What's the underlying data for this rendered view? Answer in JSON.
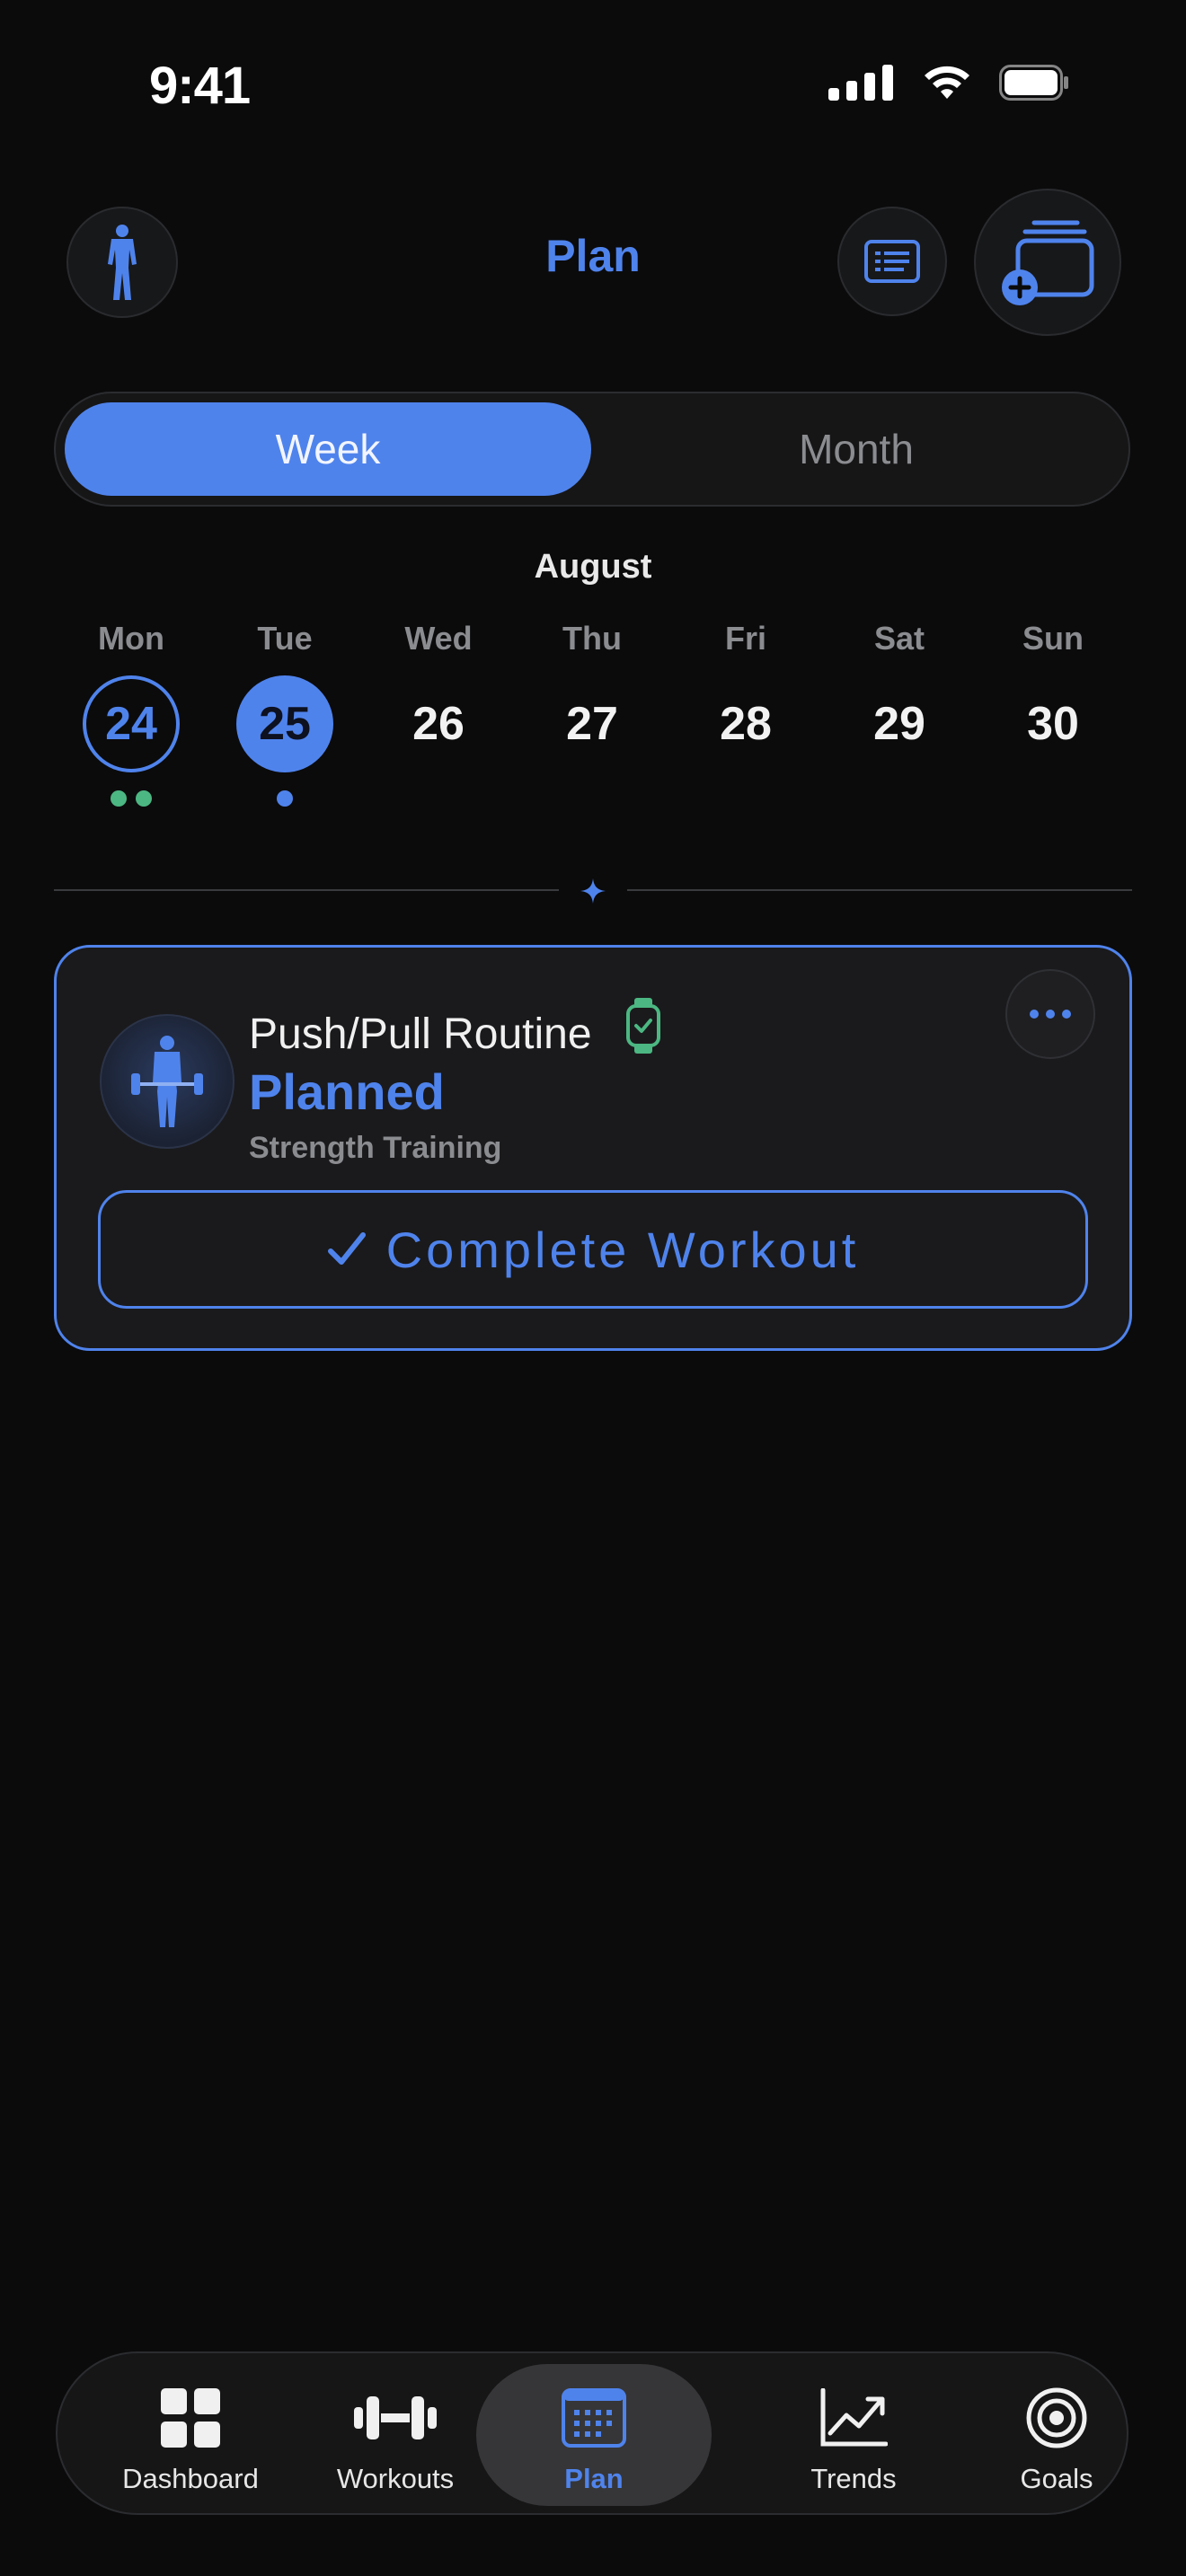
{
  "status_bar": {
    "time": "9:41"
  },
  "header": {
    "title": "Plan"
  },
  "segmented": {
    "active": "Week",
    "inactive": "Month"
  },
  "calendar": {
    "month": "August",
    "days": [
      {
        "name": "Mon",
        "num": "24"
      },
      {
        "name": "Tue",
        "num": "25"
      },
      {
        "name": "Wed",
        "num": "26"
      },
      {
        "name": "Thu",
        "num": "27"
      },
      {
        "name": "Fri",
        "num": "28"
      },
      {
        "name": "Sat",
        "num": "29"
      },
      {
        "name": "Sun",
        "num": "30"
      }
    ]
  },
  "workout_card": {
    "title": "Push/Pull Routine",
    "status": "Planned",
    "type": "Strength Training",
    "complete_label": "Complete Workout",
    "complete_icon": "checkmark-icon",
    "watch_icon": "watch-check-icon"
  },
  "tab_bar": {
    "items": [
      {
        "label": "Dashboard",
        "icon": "grid-icon"
      },
      {
        "label": "Workouts",
        "icon": "dumbbell-icon"
      },
      {
        "label": "Plan",
        "icon": "calendar-icon"
      },
      {
        "label": "Trends",
        "icon": "trend-chart-icon"
      },
      {
        "label": "Goals",
        "icon": "target-icon"
      }
    ]
  },
  "colors": {
    "accent": "#4f83ec",
    "success": "#4cb782",
    "background": "#0b0b0c",
    "surface": "#1a1a1c"
  }
}
